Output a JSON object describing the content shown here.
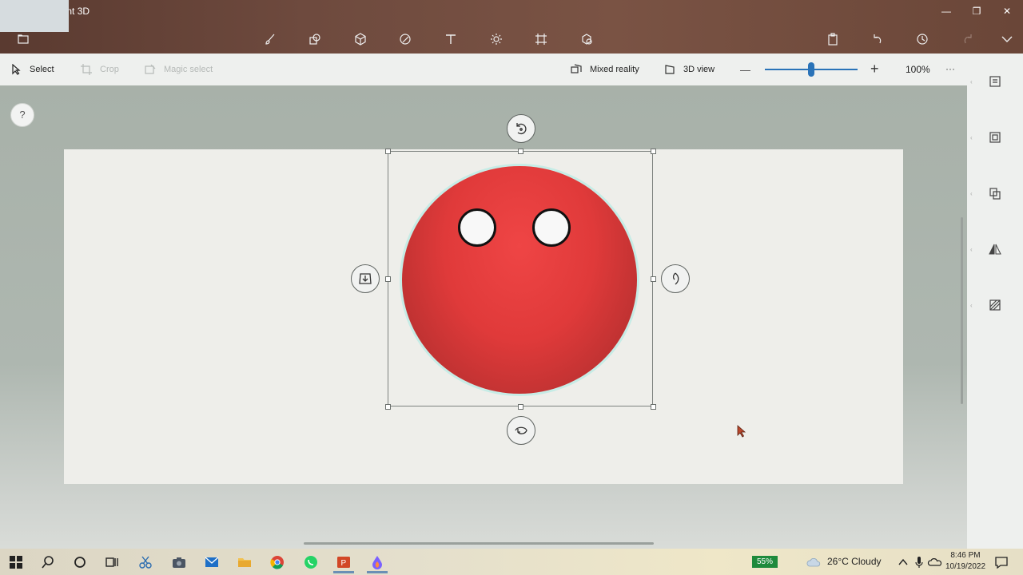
{
  "window": {
    "title": "Untitled* - Paint 3D",
    "controls": [
      "—",
      "❐",
      "✕"
    ]
  },
  "toolbar": {
    "left_icon": "folder-icon",
    "tools": [
      "brush-icon",
      "2d-shapes-icon",
      "3d-shapes-icon",
      "stickers-icon",
      "text-icon",
      "effects-icon",
      "canvas-icon",
      "3d-library-icon"
    ],
    "right_icons": [
      "paste-icon",
      "undo-icon",
      "history-icon",
      "redo-icon",
      "expand-icon"
    ]
  },
  "commandbar": {
    "select_label": "Select",
    "crop_label": "Crop",
    "magic_select_label": "Magic select",
    "mixed_reality_label": "Mixed reality",
    "view_3d_label": "3D view",
    "zoom_minus": "—",
    "zoom_plus": "+",
    "zoom_percent": "100%",
    "zoom_level": 0.5,
    "more": "···"
  },
  "help": {
    "label": "?"
  },
  "taskbar": {
    "battery": "55%",
    "weather": "26°C  Cloudy",
    "time": "8:46 PM",
    "date": "10/19/2022"
  },
  "colors": {
    "ball": "#e03a3a",
    "accent": "#2a73b8",
    "battery": "#1e8a3c"
  }
}
